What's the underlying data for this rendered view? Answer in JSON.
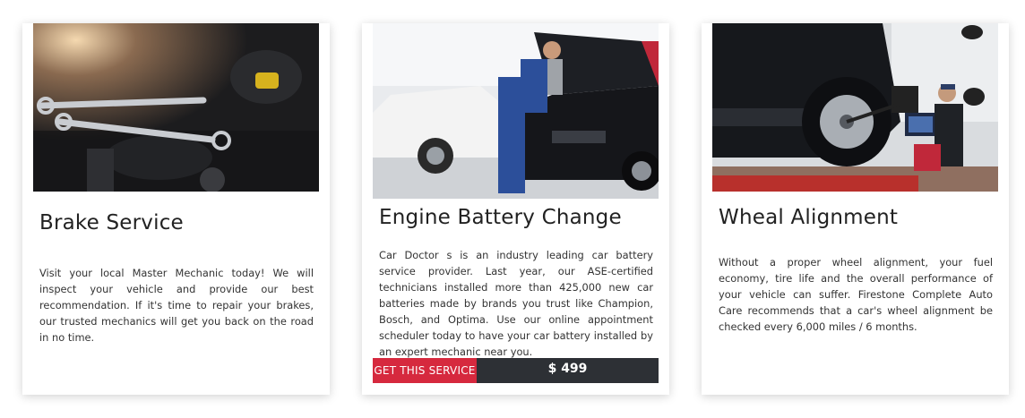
{
  "cards": [
    {
      "title": "Brake Service",
      "description": "Visit your local Master Mechanic today! We will inspect your vehicle and provide our best recommendation. If it's time to repair your brakes, our trusted mechanics will get you back on the road in no time.",
      "photo_icon": "engine-wrenches-photo"
    },
    {
      "title": "Engine Battery Change",
      "description": "Car Doctor s is an industry leading car battery service provider. Last year, our ASE-certified technicians installed more than 425,000 new car batteries made by brands you trust like Champion, Bosch, and Optima. Use our online appointment scheduler today to have your car battery installed by an expert mechanic near you.",
      "photo_icon": "mechanic-open-hood-photo",
      "button_label": "GET THIS SERVICE",
      "price": "$ 499"
    },
    {
      "title": "Wheal Alignment",
      "description": "Without a proper wheel alignment, your fuel economy, tire life and the overall performance of your vehicle can suffer. Firestone Complete Auto Care recommends that a car's wheel alignment be checked every 6,000 miles / 6 months.",
      "photo_icon": "wheel-alignment-photo"
    }
  ],
  "colors": {
    "accent_red": "#d6293e",
    "dark_bar": "#2d3035"
  }
}
